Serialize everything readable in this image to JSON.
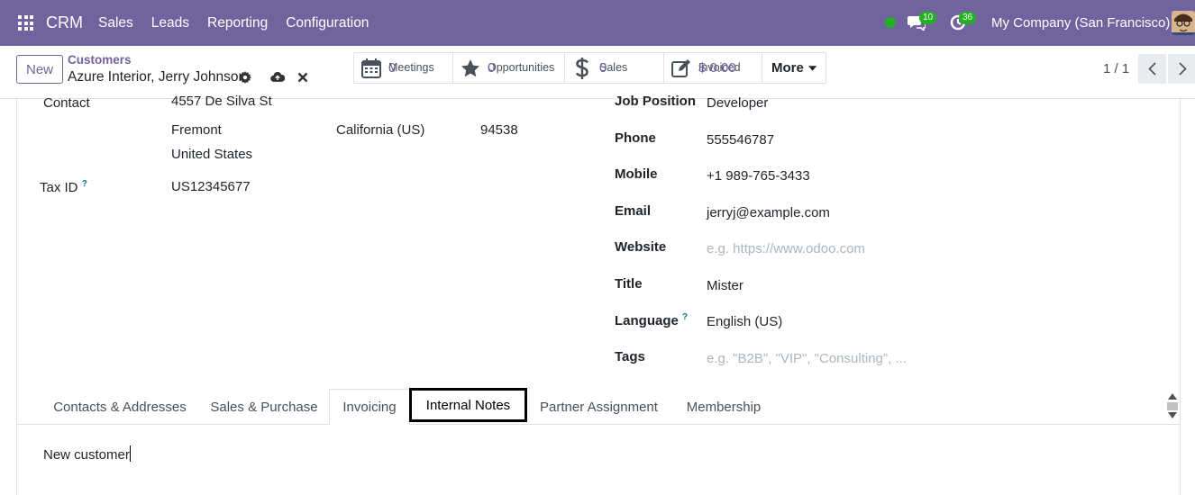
{
  "nav": {
    "brand": "CRM",
    "menu": [
      "Sales",
      "Leads",
      "Reporting",
      "Configuration"
    ],
    "chat_count": "10",
    "activity_count": "36",
    "company": "My Company (San Francisco)",
    "accent": "#71639e"
  },
  "control": {
    "new_label": "New",
    "breadcrumb": "Customers",
    "record_name": "Azure Interior, Jerry Johnson",
    "smart_buttons": [
      {
        "label": "Meetings",
        "value": "0",
        "icon": "calendar-icon"
      },
      {
        "label": "Opportunities",
        "value": "0",
        "icon": "star-icon"
      },
      {
        "label": "Sales",
        "value": "0",
        "icon": "dollar-icon"
      },
      {
        "label": "Invoiced",
        "value": "$ 0.00",
        "icon": "pencil-square-icon"
      }
    ],
    "more_label": "More",
    "pager": "1 / 1"
  },
  "form": {
    "contact_label": "Contact",
    "street": "4557 De Silva St",
    "city": "Fremont",
    "state": "California (US)",
    "zip": "94538",
    "country": "United States",
    "tax_id_label": "Tax ID",
    "tax_id": "US12345677",
    "job_position_label": "Job Position",
    "job_position": "Developer",
    "phone_label": "Phone",
    "phone": "555546787",
    "mobile_label": "Mobile",
    "mobile": "+1 989-765-3433",
    "email_label": "Email",
    "email": "jerryj@example.com",
    "website_label": "Website",
    "website_placeholder": "e.g. https://www.odoo.com",
    "title_label": "Title",
    "title": "Mister",
    "language_label": "Language",
    "language": "English (US)",
    "tags_label": "Tags",
    "tags_placeholder": "e.g. \"B2B\", \"VIP\", \"Consulting\", ...",
    "help_mark": "?"
  },
  "tabs": [
    "Contacts & Addresses",
    "Sales & Purchase",
    "Invoicing",
    "Internal Notes",
    "Partner Assignment",
    "Membership"
  ],
  "notes": {
    "text": "New customer"
  }
}
